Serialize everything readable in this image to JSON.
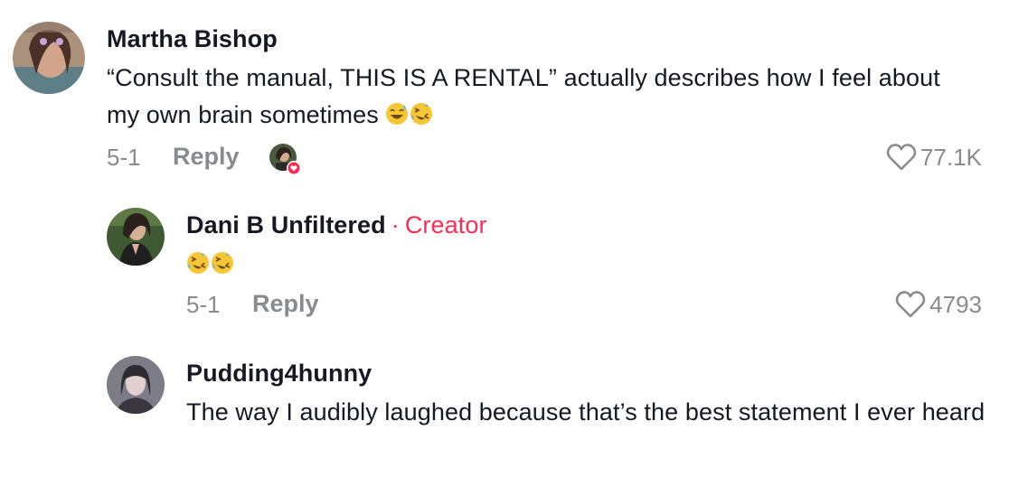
{
  "comments": [
    {
      "username": "Martha Bishop",
      "text": "“Consult the manual, THIS IS A RENTAL” actually describes how I feel about my own brain sometimes",
      "emojis": [
        "sweat-smile-emoji",
        "rofl-emoji"
      ],
      "date": "5-1",
      "reply_label": "Reply",
      "likes": "77.1K",
      "creator_liked": true
    },
    {
      "username": "Dani B Unfiltered",
      "creator_separator": "·",
      "creator_label": "Creator",
      "text": "",
      "emojis": [
        "rofl-emoji",
        "rofl-emoji"
      ],
      "date": "5-1",
      "reply_label": "Reply",
      "likes": "4793"
    },
    {
      "username": "Pudding4hunny",
      "text": "The way I audibly laughed because that’s the best statement I ever heard"
    }
  ],
  "colors": {
    "text": "#161823",
    "muted": "#8a8b91",
    "creator": "#fe2c55"
  }
}
